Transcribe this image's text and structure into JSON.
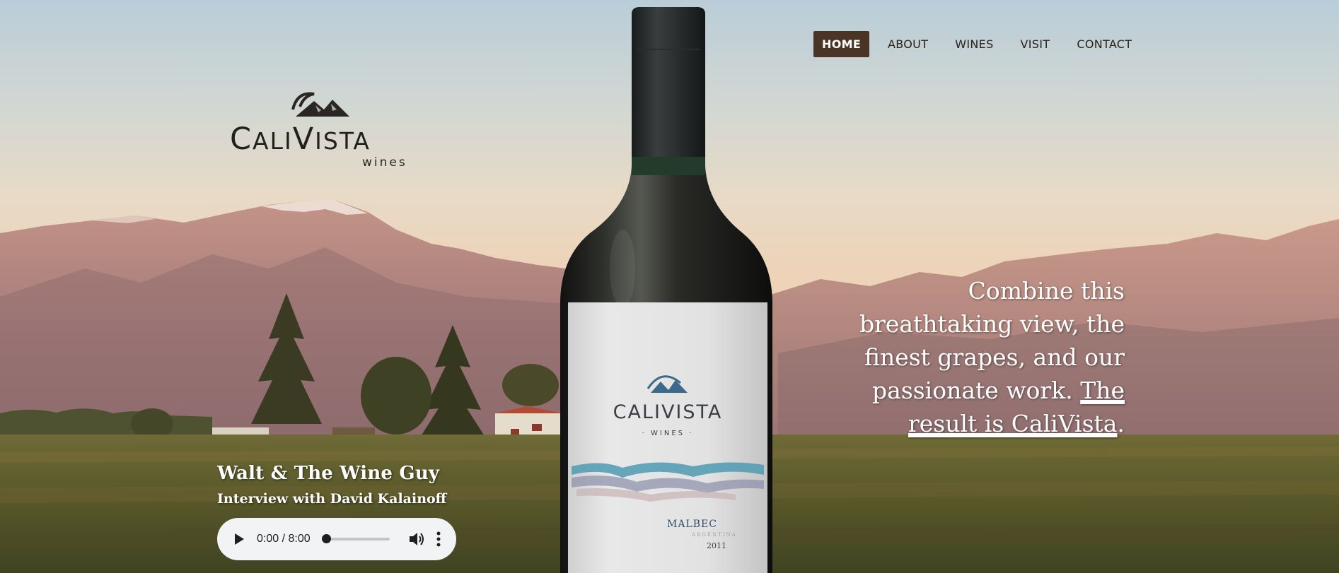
{
  "nav": {
    "items": [
      {
        "label": "HOME",
        "active": true
      },
      {
        "label": "ABOUT",
        "active": false
      },
      {
        "label": "WINES",
        "active": false
      },
      {
        "label": "VISIT",
        "active": false
      },
      {
        "label": "CONTACT",
        "active": false
      }
    ]
  },
  "logo": {
    "brand_cali": "C",
    "brand_cali_rest": "ALI",
    "brand_vista": "V",
    "brand_vista_rest": "ISTA",
    "sub": "wines"
  },
  "hero": {
    "tagline_text": "Combine this breathtaking view, the finest grapes, and our passionate work.",
    "tagline_link": "The result is CaliVista",
    "tagline_end": "."
  },
  "bottle": {
    "label_brand": "CALIVISTA",
    "label_sub": "· WINES ·",
    "label_varietal": "MALBEC",
    "label_origin": "ARGENTINA",
    "label_year": "2011"
  },
  "interview": {
    "title": "Walt & The Wine Guy",
    "subtitle": "Interview with David Kalainoff"
  },
  "audio": {
    "time": "0:00 / 8:00",
    "progress": 0
  },
  "icons": {
    "play": "play-icon",
    "volume": "volume-icon",
    "more": "more-vertical-icon",
    "logo": "mountain-logo-icon"
  },
  "colors": {
    "nav_active_bg": "#4a3426",
    "nav_text": "#2b211a",
    "audio_bg": "#f1f3f4"
  }
}
